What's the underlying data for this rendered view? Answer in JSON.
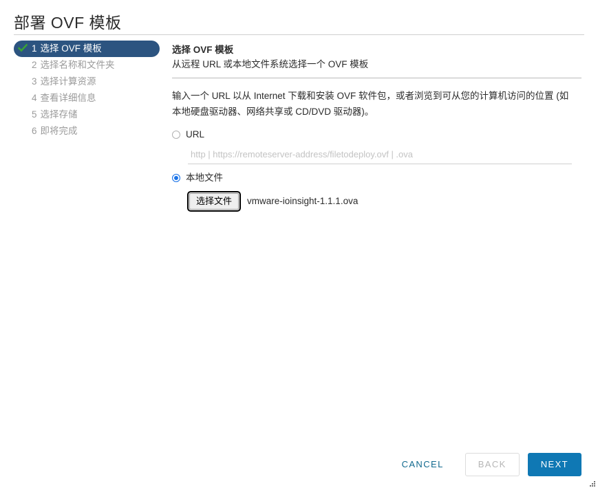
{
  "window": {
    "title": "部署 OVF 模板"
  },
  "steps": [
    {
      "num": "1",
      "label": "选择 OVF 模板",
      "state": "active",
      "completed": true
    },
    {
      "num": "2",
      "label": "选择名称和文件夹",
      "state": "pending",
      "completed": false
    },
    {
      "num": "3",
      "label": "选择计算资源",
      "state": "pending",
      "completed": false
    },
    {
      "num": "4",
      "label": "查看详细信息",
      "state": "pending",
      "completed": false
    },
    {
      "num": "5",
      "label": "选择存储",
      "state": "pending",
      "completed": false
    },
    {
      "num": "6",
      "label": "即将完成",
      "state": "pending",
      "completed": false
    }
  ],
  "pane": {
    "title": "选择 OVF 模板",
    "subtitle": "从远程 URL 或本地文件系统选择一个 OVF 模板",
    "description": "输入一个 URL 以从 Internet 下载和安装 OVF 软件包，或者浏览到可从您的计算机访问的位置 (如本地硬盘驱动器、网络共享或 CD/DVD 驱动器)。"
  },
  "source": {
    "url_option_label": "URL",
    "url_selected": false,
    "url_value": "",
    "url_placeholder": "http | https://remoteserver-address/filetodeploy.ovf | .ova",
    "local_option_label": "本地文件",
    "local_selected": true,
    "file_button_label": "选择文件",
    "file_name": "vmware-ioinsight-1.1.1.ova"
  },
  "footer": {
    "cancel_label": "CANCEL",
    "back_label": "BACK",
    "back_disabled": true,
    "next_label": "NEXT"
  },
  "colors": {
    "active_step_bg": "#2c5480",
    "check_green": "#3aa236",
    "radio_blue": "#1a73e8",
    "next_blue": "#0f78b4",
    "cancel_teal": "#11698e",
    "muted_text": "#9b9b9b"
  },
  "icons": {
    "check": "check-icon",
    "resize_grip": "resize-grip-icon"
  }
}
